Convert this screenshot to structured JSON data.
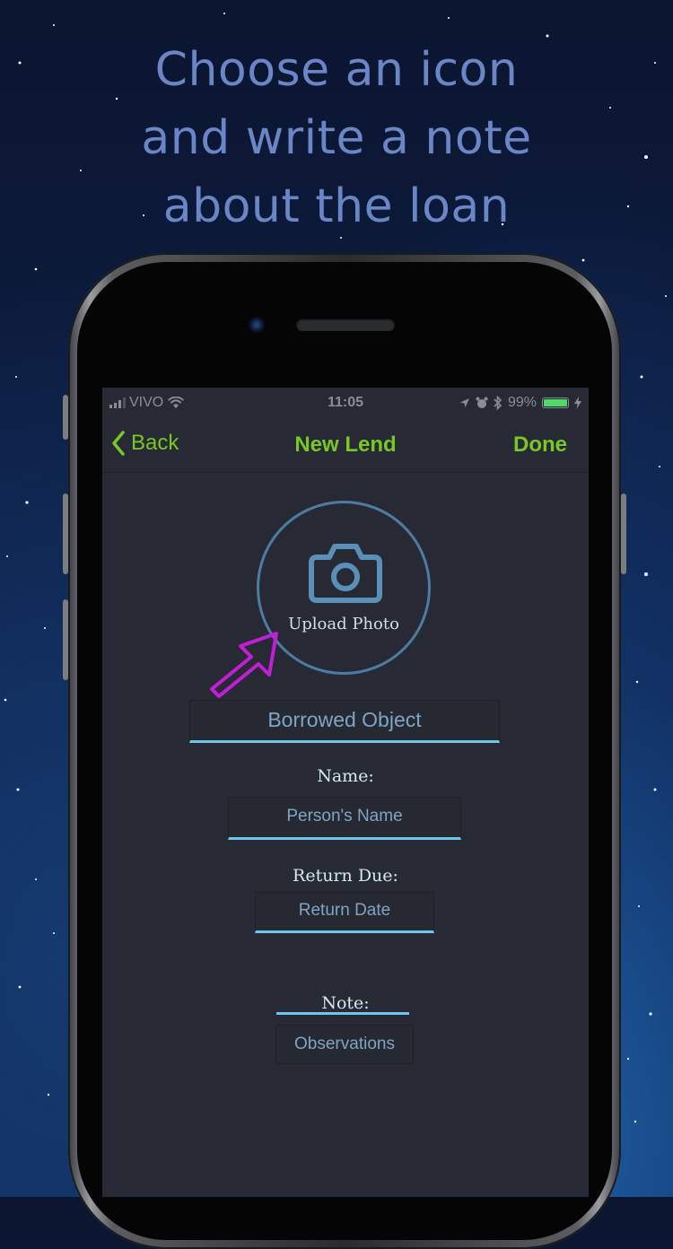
{
  "headline": {
    "line1": "Choose an icon",
    "line2": "and write a note",
    "line3": "about the loan"
  },
  "status_bar": {
    "carrier": "VIVO",
    "time": "11:05",
    "battery": "99%",
    "battery_level": 0.99
  },
  "nav": {
    "back_label": "Back",
    "title": "New Lend",
    "done_label": "Done"
  },
  "upload": {
    "label": "Upload Photo"
  },
  "form": {
    "object_placeholder": "Borrowed Object",
    "name_label": "Name:",
    "name_placeholder": "Person's Name",
    "return_label": "Return Due:",
    "return_placeholder": "Return Date",
    "note_label": "Note:",
    "note_placeholder": "Observations"
  },
  "colors": {
    "accent_green": "#79c724",
    "field_underline": "#6fc6ec",
    "pointer_arrow": "#c21ed6",
    "headline": "#6b86c6"
  },
  "icons": [
    "signal-icon",
    "wifi-icon",
    "location-icon",
    "alarm-icon",
    "bluetooth-icon",
    "battery-icon",
    "charging-icon",
    "chevron-left-icon",
    "camera-icon",
    "pointer-arrow-icon"
  ]
}
